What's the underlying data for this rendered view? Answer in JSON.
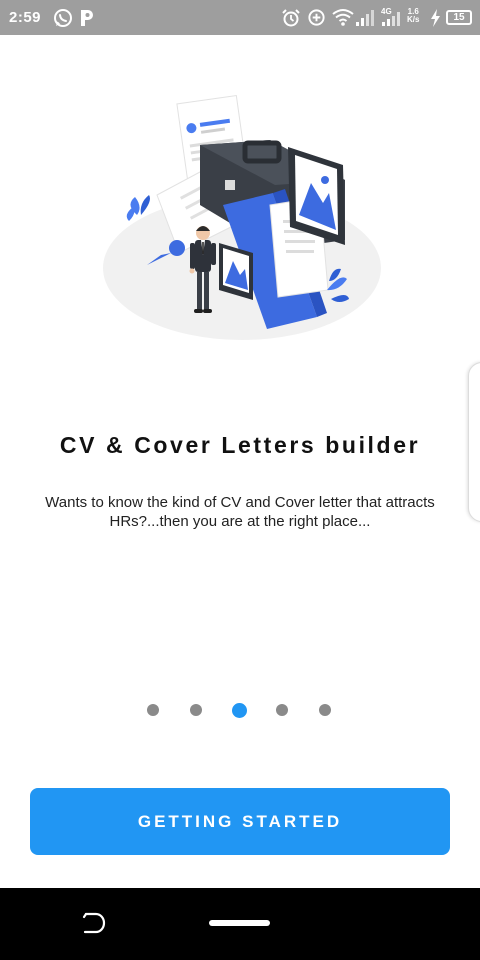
{
  "status_bar": {
    "time": "2:59",
    "network_speed_value": "1.6",
    "network_speed_unit": "K/s",
    "battery_level": "15",
    "icons": [
      "whatsapp-icon",
      "p-app-icon",
      "alarm-icon",
      "data-saver-icon",
      "wifi-icon",
      "signal-icon",
      "4g-signal-icon",
      "charging-icon",
      "battery-icon"
    ]
  },
  "onboarding": {
    "illustration": "cv-builder-illustration",
    "title": "CV & Cover Letters builder",
    "description": "Wants to know the kind of CV and Cover letter that attracts HRs?...then you are at the right place...",
    "page_count": 5,
    "active_page": 3,
    "cta_label": "GETTING STARTED"
  },
  "colors": {
    "accent": "#2196f3",
    "status_bar": "#9e9e9e",
    "inactive_dot": "#8a8a8a",
    "nav_bar": "#000000"
  },
  "nav_bar": {
    "icons": [
      "back-icon",
      "home-pill-icon"
    ]
  }
}
